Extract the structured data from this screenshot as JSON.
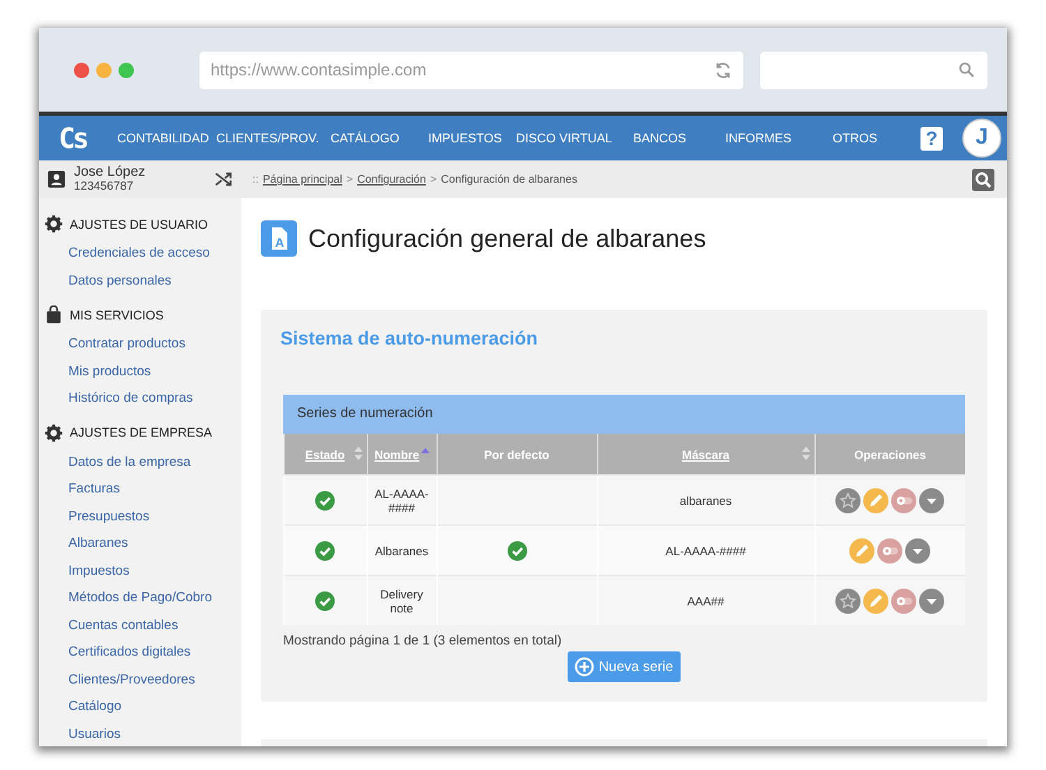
{
  "browser": {
    "url": "https://www.contasimple.com"
  },
  "nav": {
    "logo": "Cs",
    "items": [
      "CONTABILIDAD",
      "CLIENTES/PROV.",
      "CATÁLOGO",
      "IMPUESTOS",
      "DISCO VIRTUAL",
      "BANCOS",
      "INFORMES",
      "OTROS"
    ],
    "help": "?",
    "avatar": "J"
  },
  "user": {
    "name": "Jose López",
    "id": "123456787"
  },
  "breadcrumb": {
    "prefix": "::",
    "separator": ">",
    "items": [
      {
        "label": "Página principal",
        "link": true
      },
      {
        "label": "Configuración",
        "link": true
      },
      {
        "label": "Configuración de albaranes",
        "link": false
      }
    ]
  },
  "sidebar": {
    "sections": [
      {
        "title": "AJUSTES DE USUARIO",
        "items": [
          "Credenciales de acceso",
          "Datos personales"
        ]
      },
      {
        "title": "MIS SERVICIOS",
        "items": [
          "Contratar productos",
          "Mis productos",
          "Histórico de compras"
        ]
      },
      {
        "title": "AJUSTES DE EMPRESA",
        "items": [
          "Datos de la empresa",
          "Facturas",
          "Presupuestos",
          "Albaranes",
          "Impuestos",
          "Métodos de Pago/Cobro",
          "Cuentas contables",
          "Certificados digitales",
          "Clientes/Proveedores",
          "Catálogo",
          "Usuarios"
        ]
      }
    ]
  },
  "page": {
    "icon_letter": "A",
    "title": "Configuración general de albaranes"
  },
  "section": {
    "title": "Sistema de auto-numeración",
    "table": {
      "title": "Series de numeración",
      "columns": [
        {
          "label": "Estado",
          "kind": "sortable"
        },
        {
          "label": "Nombre",
          "kind": "sorted"
        },
        {
          "label": "Por defecto",
          "kind": "plain"
        },
        {
          "label": "Máscara",
          "kind": "sortable"
        },
        {
          "label": "Operaciones",
          "kind": "plain"
        }
      ],
      "rows": [
        {
          "active": true,
          "name": "AL-AAAA-####",
          "default": false,
          "mask": "albaranes"
        },
        {
          "active": true,
          "name": "Albaranes",
          "default": true,
          "mask": "AL-AAAA-####"
        },
        {
          "active": true,
          "name": "Delivery note",
          "default": false,
          "mask": "AAA##"
        }
      ]
    },
    "pagination": "Mostrando página 1 de 1 (3 elementos en total)",
    "new_button": "Nueva serie"
  }
}
